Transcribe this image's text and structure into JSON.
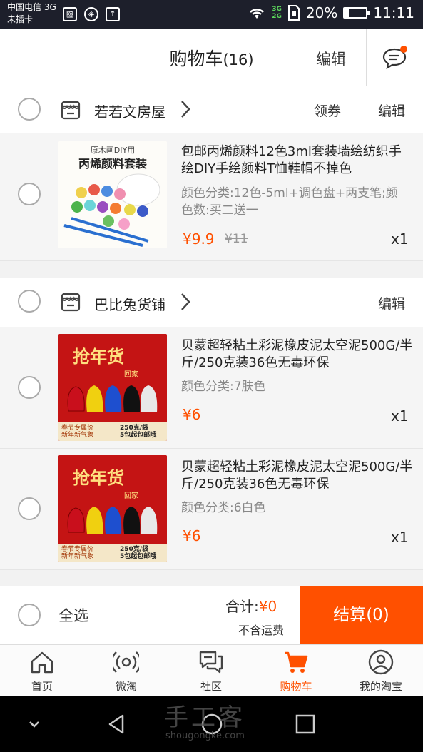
{
  "status_bar": {
    "carrier": "中国电信 3G",
    "sim": "未插卡",
    "net_top": "3G",
    "net_bottom": "2G",
    "battery": "20%",
    "battery_level": 0.2,
    "time": "11:11"
  },
  "header": {
    "title": "购物车",
    "count": "(16)",
    "edit": "编辑",
    "has_notification": true
  },
  "shops": [
    {
      "name": "若若文房屋",
      "coupon": "领券",
      "edit": "编辑",
      "items": [
        {
          "title": "包邮丙烯颜料12色3ml套装墙绘纺织手绘DIY手绘颜料T恤鞋帽不掉色",
          "spec": "颜色分类:12色-5ml+调色盘+两支笔;颜色数:买二送一",
          "price": "¥9.9",
          "old_price": "¥11",
          "qty": "x1",
          "thumb_caption_top": "原木画DIY用",
          "thumb_caption": "丙烯颜料套装"
        }
      ]
    },
    {
      "name": "巴比兔货铺",
      "coupon": "",
      "edit": "编辑",
      "items": [
        {
          "title": "贝蒙超轻粘土彩泥橡皮泥太空泥500G/半斤/250克装36色无毒环保",
          "spec": "颜色分类:7肤色",
          "price": "¥6",
          "qty": "x1",
          "thumb_banner": "抢年货",
          "thumb_tag": "回家",
          "thumb_left": "春节专属价\n新年新气象",
          "thumb_right": "250克/袋\n5包起包邮哦"
        },
        {
          "title": "贝蒙超轻粘土彩泥橡皮泥太空泥500G/半斤/250克装36色无毒环保",
          "spec": "颜色分类:6白色",
          "price": "¥6",
          "qty": "x1",
          "thumb_banner": "抢年货",
          "thumb_tag": "回家",
          "thumb_left": "春节专属价\n新年新气象",
          "thumb_right": "250克/袋\n5包起包邮哦"
        }
      ]
    }
  ],
  "footer": {
    "select_all": "全选",
    "total_label": "合计:",
    "total_value": "¥0",
    "shipping_note": "不含运费",
    "checkout": "结算(0)"
  },
  "tabs": [
    {
      "label": "首页",
      "icon": "home-icon",
      "active": false
    },
    {
      "label": "微淘",
      "icon": "broadcast-icon",
      "active": false
    },
    {
      "label": "社区",
      "icon": "community-icon",
      "active": false
    },
    {
      "label": "购物车",
      "icon": "cart-icon",
      "active": true
    },
    {
      "label": "我的淘宝",
      "icon": "profile-icon",
      "active": false
    }
  ],
  "watermark": {
    "text": "手工客",
    "sub": "shougongke.com"
  },
  "colors": {
    "accent": "#ff5000",
    "status_bar": "#1d1f2b"
  }
}
